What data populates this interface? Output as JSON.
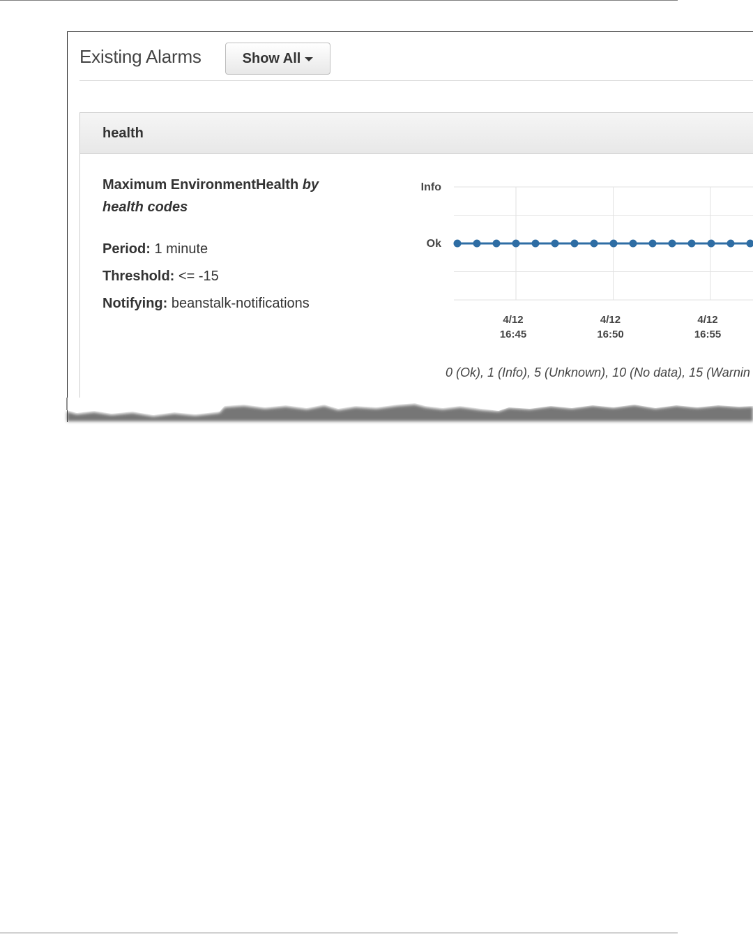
{
  "header": {
    "title": "Existing Alarms",
    "filter_button_label": "Show All"
  },
  "alarm": {
    "name": "health",
    "metric_prefix": "Maximum EnvironmentHealth",
    "metric_suffix": "by health codes",
    "details": [
      {
        "label": "Period:",
        "value": "1 minute"
      },
      {
        "label": "Threshold:",
        "value": "<= -15"
      },
      {
        "label": "Notifying:",
        "value": "beanstalk-notifications"
      }
    ]
  },
  "chart_data": {
    "type": "line",
    "y_tick_labels": [
      "Info",
      "Ok"
    ],
    "x_tick_labels": [
      [
        "4/12",
        "16:45"
      ],
      [
        "4/12",
        "16:50"
      ],
      [
        "4/12",
        "16:55"
      ]
    ],
    "series": [
      {
        "values": [
          0,
          0,
          0,
          0,
          0,
          0,
          0,
          0,
          0,
          0,
          0,
          0,
          0,
          0,
          0,
          0
        ]
      }
    ],
    "series_color": "#2e6da4",
    "grid": true,
    "legend_note": "0 (Ok), 1 (Info), 5 (Unknown), 10 (No data), 15 (Warnin"
  }
}
